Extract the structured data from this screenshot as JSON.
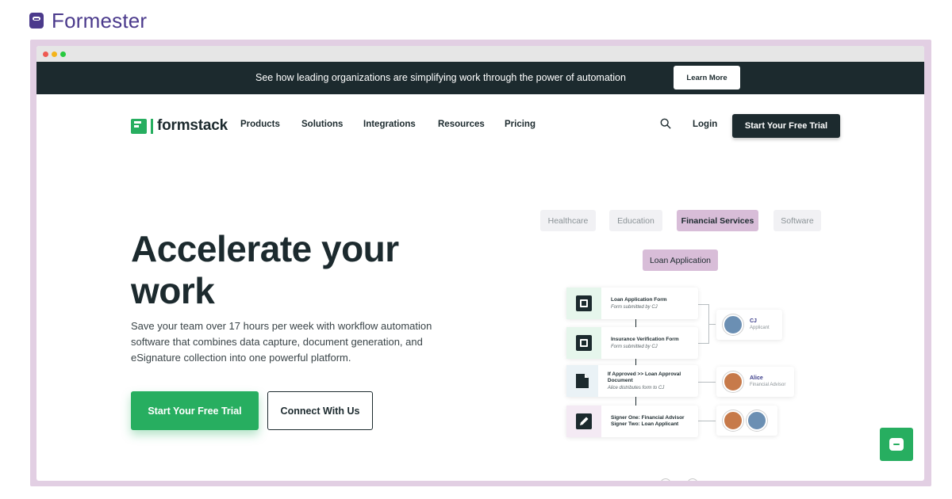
{
  "brand": {
    "name": "Formester"
  },
  "banner": {
    "text": "See how leading organizations are simplifying work through the power of automation",
    "button": "Learn More"
  },
  "nav": {
    "logo": "formstack",
    "items": [
      "Products",
      "Solutions",
      "Integrations",
      "Resources",
      "Pricing"
    ],
    "login": "Login",
    "cta": "Start Your Free Trial"
  },
  "hero": {
    "title": "Accelerate your work",
    "subtitle": "Save your team over 17 hours per week with workflow automation software that combines data capture, document generation, and eSignature collection into one powerful platform.",
    "primary_button": "Start Your Free Trial",
    "secondary_button": "Connect With Us"
  },
  "industry_tabs": {
    "items": [
      "Healthcare",
      "Education",
      "Financial Services",
      "Software"
    ],
    "active": "Financial Services"
  },
  "workflow": {
    "tag": "Loan Application",
    "steps": [
      {
        "title": "Loan Application Form",
        "desc": "Form submitted by CJ",
        "icon": "form-icon"
      },
      {
        "title": "Insurance Verification Form",
        "desc": "Form submitted by CJ",
        "icon": "form-icon"
      },
      {
        "title": "If Approved >> Loan Approval Document",
        "desc": "Alice distributes form to CJ",
        "icon": "document-icon"
      },
      {
        "title": "Signer One: Financial Advisor",
        "desc": "Signer Two: Loan Applicant",
        "icon": "pen-icon"
      }
    ],
    "people": [
      {
        "name": "CJ",
        "role": "Applicant"
      },
      {
        "name": "Alice",
        "role": "Financial Advisor"
      }
    ]
  },
  "colors": {
    "brand": "#4b3a8c",
    "dark": "#1c2a2e",
    "accent_green": "#27ae60",
    "active_pill": "#d8bdd8",
    "frame": "#e2cfe3"
  }
}
